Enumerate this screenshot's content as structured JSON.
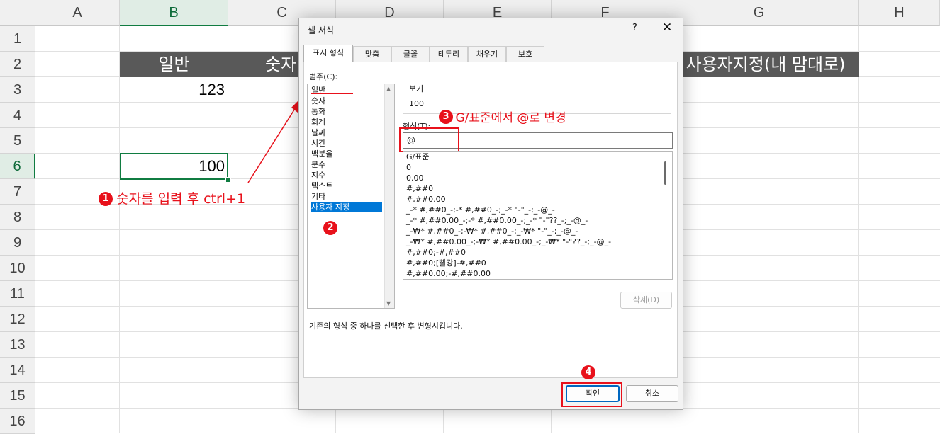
{
  "sheet": {
    "columns": [
      "A",
      "B",
      "C",
      "D",
      "E",
      "F",
      "G",
      "H"
    ],
    "selected_column": "B",
    "rows": [
      "1",
      "2",
      "3",
      "4",
      "5",
      "6",
      "7",
      "8",
      "9",
      "10",
      "11",
      "12",
      "13",
      "14",
      "15",
      "16"
    ],
    "selected_row": "6",
    "header_row": {
      "b": "일반",
      "c": "숫자",
      "g": "사용자지정(내 맘대로)"
    },
    "cells": {
      "b3": "123",
      "b6": "100"
    },
    "colors": {
      "header_fill": "#595959",
      "selection": "#107c41",
      "annotation": "#e8111b"
    }
  },
  "annotations": {
    "step1": {
      "badge": "1",
      "text": "숫자를 입력 후 ctrl+1"
    },
    "step2": {
      "badge": "2"
    },
    "step3": {
      "badge": "3",
      "text": "G/표준에서 @로 변경"
    },
    "step4": {
      "badge": "4"
    }
  },
  "dialog": {
    "title": "셀 서식",
    "help_label": "?",
    "close_label": "✕",
    "tabs": [
      {
        "label": "표시 형식",
        "active": true
      },
      {
        "label": "맞춤"
      },
      {
        "label": "글꼴"
      },
      {
        "label": "테두리"
      },
      {
        "label": "채우기"
      },
      {
        "label": "보호"
      }
    ],
    "category_label": "범주(C):",
    "categories": [
      "일반",
      "숫자",
      "통화",
      "회계",
      "날짜",
      "시간",
      "백분율",
      "분수",
      "지수",
      "텍스트",
      "기타",
      "사용자 지정"
    ],
    "selected_category": "사용자 지정",
    "sample_label": "보기",
    "sample_value": "100",
    "type_label": "형식(T):",
    "type_value": "@",
    "format_list": [
      "G/표준",
      "0",
      "0.00",
      "#,##0",
      "#,##0.00",
      "_-* #,##0_-;-* #,##0_-;_-* \"-\"_-;_-@_-",
      "_-* #,##0.00_-;-* #,##0.00_-;_-* \"-\"??_-;_-@_-",
      "_-₩* #,##0_-;-₩* #,##0_-;_-₩* \"-\"_-;_-@_-",
      "_-₩* #,##0.00_-;-₩* #,##0.00_-;_-₩* \"-\"??_-;_-@_-",
      "#,##0;-#,##0",
      "#,##0;[빨강]-#,##0",
      "#,##0.00;-#,##0.00"
    ],
    "delete_label": "삭제(D)",
    "description": "기존의 형식 중 하나를 선택한 후 변형시킵니다.",
    "ok_label": "확인",
    "cancel_label": "취소"
  }
}
